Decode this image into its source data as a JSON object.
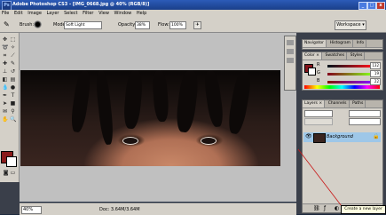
{
  "window": {
    "app_icon": "Ps",
    "title": "Adobe Photoshop CS3 - [IMG_0668.jpg @ 40% (RGB/8)]",
    "minimize_label": "_",
    "maximize_label": "□",
    "close_label": "x"
  },
  "menu": [
    "File",
    "Edit",
    "Image",
    "Layer",
    "Select",
    "Filter",
    "View",
    "Window",
    "Help"
  ],
  "options_bar": {
    "brush_label": "Brush:",
    "mode_label": "Mode:",
    "mode_value": "Soft Light",
    "opacity_label": "Opacity:",
    "opacity_value": "38%",
    "flow_label": "Flow:",
    "flow_value": "100%",
    "workspace_label": "Workspace ▾"
  },
  "navigator_panel": {
    "tabs": [
      "Navigator",
      "Histogram",
      "Info"
    ]
  },
  "color_panel": {
    "tabs": [
      "Color ×",
      "Swatches",
      "Styles"
    ],
    "channels": [
      {
        "label": "R",
        "value": "132"
      },
      {
        "label": "G",
        "value": "19"
      },
      {
        "label": "B",
        "value": "22"
      }
    ],
    "foreground_color": "#84131a"
  },
  "layers_panel": {
    "tabs": [
      "Layers ×",
      "Channels",
      "Paths"
    ],
    "layer_name": "Background"
  },
  "status": {
    "zoom": "40%",
    "doc": "Doc: 3.64M/3.64M"
  },
  "tooltip": "Create a new layer",
  "colors": {
    "accent_blue": "#2c5bb8",
    "selected_layer": "#9ec7e8"
  }
}
